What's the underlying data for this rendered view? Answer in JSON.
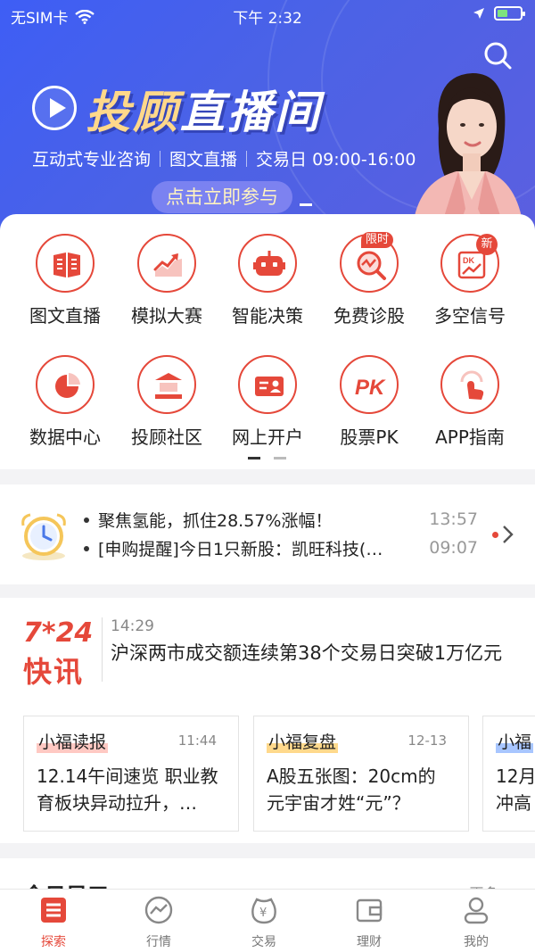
{
  "status_bar": {
    "carrier": "无SIM卡",
    "time": "下午 2:32",
    "battery_level": 0.45
  },
  "banner": {
    "title_a": "投顾",
    "title_b": "直播间",
    "subtitle": [
      "互动式专业咨询",
      "图文直播",
      "交易日 09:00-16:00"
    ],
    "cta": "点击立即参与"
  },
  "grid": {
    "items": [
      {
        "label": "图文直播",
        "icon": "book-icon"
      },
      {
        "label": "模拟大赛",
        "icon": "trend-chart-icon"
      },
      {
        "label": "智能决策",
        "icon": "robot-icon"
      },
      {
        "label": "免费诊股",
        "icon": "stock-diagnosis-icon",
        "badge": "限时"
      },
      {
        "label": "多空信号",
        "icon": "signal-icon",
        "badge": "新"
      },
      {
        "label": "数据中心",
        "icon": "pie-chart-icon"
      },
      {
        "label": "投顾社区",
        "icon": "community-icon"
      },
      {
        "label": "网上开户",
        "icon": "id-card-icon"
      },
      {
        "label": "股票PK",
        "icon": "pk-icon",
        "glyph": "PK"
      },
      {
        "label": "APP指南",
        "icon": "tap-hand-icon"
      }
    ],
    "page_count": 2,
    "current_page": 1
  },
  "ticker": {
    "items": [
      {
        "text": "聚焦氢能，抓住28.57%涨幅！",
        "time": "13:57"
      },
      {
        "text": "[申购提醒]今日1只新股：凯旺科技(…",
        "time": "09:07"
      }
    ]
  },
  "flash": {
    "logo_num": "7*24",
    "logo_text": "快讯",
    "time": "14:29",
    "headline": "沪深两市成交额连续第38个交易日突破1万亿元"
  },
  "news_cards": [
    {
      "tag": "小福读报",
      "time": "11:44",
      "body": "12.14午间速览 职业教\n育板块异动拉升，…"
    },
    {
      "tag": "小福复盘",
      "time": "12-13",
      "body": "A股五张图：20cm的\n元宇宙才姓“元”？"
    },
    {
      "tag": "小福",
      "time": "",
      "body": "12月\n冲高"
    }
  ],
  "next_section": {
    "title": "今日风口",
    "more": "更多 ›"
  },
  "tabbar": [
    {
      "label": "探索",
      "icon": "explore-icon",
      "active": true
    },
    {
      "label": "行情",
      "icon": "market-icon",
      "active": false
    },
    {
      "label": "交易",
      "icon": "trade-icon",
      "active": false
    },
    {
      "label": "理财",
      "icon": "wallet-icon",
      "active": false
    },
    {
      "label": "我的",
      "icon": "profile-icon",
      "active": false
    }
  ],
  "colors": {
    "accent": "#e5483a",
    "banner": "#4b62e6"
  }
}
